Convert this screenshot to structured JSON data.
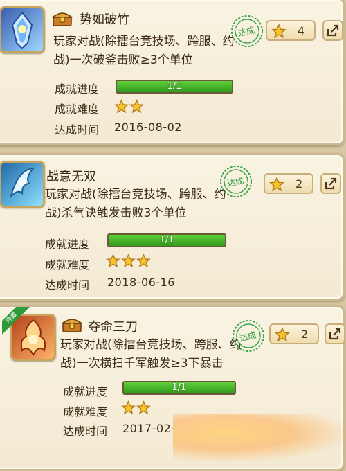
{
  "achievements": [
    {
      "title": "势如破竹",
      "has_chest": true,
      "ribbon": "",
      "description_line1": "玩家对战(除擂台竞技场、跨服、约",
      "description_line2": "战)一次破釜击败≥3个单位",
      "progress_label": "成就进度",
      "progress_text": "1/1",
      "progress_value": 1.0,
      "difficulty_label": "成就难度",
      "difficulty_stars": 2,
      "date_label": "达成时间",
      "date": "2016-08-02",
      "badge_text": "达成",
      "reward_count": "4"
    },
    {
      "title": "战意无双",
      "has_chest": false,
      "ribbon": "",
      "description_line1": "玩家对战(除擂台竞技场、跨服、约",
      "description_line2": "战)杀气诀触发击败3个单位",
      "progress_label": "成就进度",
      "progress_text": "1/1",
      "progress_value": 1.0,
      "difficulty_label": "成就难度",
      "difficulty_stars": 3,
      "date_label": "达成时间",
      "date": "2018-06-16",
      "badge_text": "达成",
      "reward_count": "2"
    },
    {
      "title": "夺命三刀",
      "has_chest": true,
      "ribbon": "隐藏",
      "description_line1": "玩家对战(除擂台竞技场、跨服、约",
      "description_line2": "战)一次横扫千军触发≥3下暴击",
      "progress_label": "成就进度",
      "progress_text": "1/1",
      "progress_value": 1.0,
      "difficulty_label": "成就难度",
      "difficulty_stars": 2,
      "date_label": "达成时间",
      "date": "2017-02-",
      "badge_text": "达成",
      "reward_count": "2"
    }
  ],
  "colors": {
    "progress_fill": "#3fb326",
    "star": "#f7c42a",
    "badge": "#3aa54a"
  }
}
